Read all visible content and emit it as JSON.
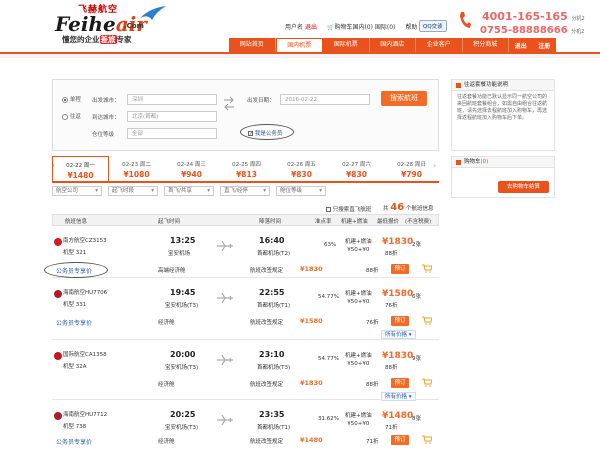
{
  "header": {
    "logo_cn": "飞赫航空",
    "logo_en_a": "Feihe",
    "logo_en_b": "air",
    "logo_com": ".Com",
    "slogan_a": "懂您的企业",
    "slogan_hl": "差旅",
    "slogan_b": "专家",
    "user_center": "用户名",
    "user_link": "退出",
    "cart_text": "购物车",
    "cart_count": "国内(0) 国际(0)",
    "help": "帮助",
    "qq": "QQ交谈",
    "phone1": "4001-165-165",
    "phone1_suffix": "分机2",
    "phone2": "0755-88888666",
    "phone2_suffix": "分机2"
  },
  "nav": {
    "items": [
      "网站首页",
      "国内机票",
      "国际机票",
      "国内酒店",
      "企业客户",
      "积分商城"
    ],
    "active_index": 1,
    "right": [
      "退出",
      "注册"
    ]
  },
  "search": {
    "trip_one": "单程",
    "trip_round": "往返",
    "from_label": "出发城市：",
    "from_value": "深圳",
    "to_label": "到达城市：",
    "to_value": "北京(首都)",
    "cabin_label": "仓位等级",
    "cabin_value": "全部",
    "date_label": "出发日期：",
    "date_value": "2016-02-22",
    "official_label": "我是公务员",
    "search_button": "搜索航班"
  },
  "side": {
    "notice_title": "往返套餐功能说明",
    "notice_body": "往返套餐功能已默认显示同一航空公司的来回航班套餐组合，如需自由组合往返航班，请先选择去程航班加入购物车，再选择返程航班加入购物车后下单。",
    "cart_title": "购物车",
    "cart_count": "(0)",
    "cart_button": "去购物车结算"
  },
  "dates": [
    {
      "date": "02-22",
      "dow": "周一",
      "price": "¥1480",
      "active": true
    },
    {
      "date": "02-23",
      "dow": "周二",
      "price": "¥1080",
      "active": false
    },
    {
      "date": "02-24",
      "dow": "周三",
      "price": "¥940",
      "active": false
    },
    {
      "date": "02-25",
      "dow": "周四",
      "price": "¥813",
      "active": false
    },
    {
      "date": "02-26",
      "dow": "周五",
      "price": "¥830",
      "active": false
    },
    {
      "date": "02-27",
      "dow": "周六",
      "price": "¥830",
      "active": false
    },
    {
      "date": "02-28",
      "dow": "周日",
      "price": "¥790",
      "active": false
    }
  ],
  "filters": [
    "航空公司",
    "起飞时段",
    "首飞/共享",
    "直飞/经停",
    "舱位等级"
  ],
  "results": {
    "direct_only": "只搜索直飞航班",
    "count_prefix": "共",
    "count": "46",
    "count_suffix": "个航班信息",
    "columns": [
      "航班信息",
      "起飞时间",
      "降落时间",
      "准点率",
      "机建+燃油",
      "最低报价",
      "(不含税费)"
    ]
  },
  "flights": [
    {
      "airline": "南方航空CZ3153",
      "model": "机型 321",
      "dep_time": "13:25",
      "dep_apt": "宝安机场",
      "arr_time": "16:40",
      "arr_apt": "首都机场(T2)",
      "ontime": "63%",
      "tax_a": "机建+燃油",
      "tax_b": "¥50+¥0",
      "price": "¥1830",
      "stock": "2张",
      "disc": "88折",
      "book": "预订",
      "sub_a": "高端经济舱",
      "sub_b": "航班改签规定",
      "sub_price": "¥1830",
      "sub_disc": "88折",
      "gwy": "公务员专享价"
    },
    {
      "airline": "海南航空HU7706",
      "model": "机型 331",
      "dep_time": "19:45",
      "dep_apt": "宝安机场(T3)",
      "arr_time": "22:55",
      "arr_apt": "首都机场(T1)",
      "ontime": "54.77%",
      "tax_a": "机建+燃油",
      "tax_b": "¥50+¥0",
      "price": "¥1580",
      "stock": "6张",
      "disc": "76折",
      "book": "预订",
      "sub_a": "经济舱",
      "sub_b": "航班改签规定",
      "sub_price": "¥1580",
      "sub_disc": "76折",
      "gwy": "公务员专享价",
      "more": "所有价格"
    },
    {
      "airline": "国际航空CA1358",
      "model": "机型 32A",
      "dep_time": "20:00",
      "dep_apt": "宝安机场(T3)",
      "arr_time": "23:10",
      "arr_apt": "首都机场(T3)",
      "ontime": "54.77%",
      "tax_a": "机建+燃油",
      "tax_b": "¥50+¥0",
      "price": "¥1830",
      "stock": "9张",
      "disc": "88折",
      "book": "预订",
      "sub_a": "经济舱",
      "sub_b": "航班改签规定",
      "sub_price": "¥1830",
      "sub_disc": "88折",
      "more": "所有价格"
    },
    {
      "airline": "海南航空HU7712",
      "model": "机型 738",
      "dep_time": "20:25",
      "dep_apt": "宝安机场(T3)",
      "arr_time": "23:35",
      "arr_apt": "首都机场(T1)",
      "ontime": "31.62%",
      "tax_a": "机建+燃油",
      "tax_b": "¥50+¥0",
      "price": "¥1480",
      "stock": "8张",
      "disc": "71折",
      "book": "预订",
      "sub_a": "经济舱",
      "sub_b": "航班改签规定",
      "sub_price": "¥1480",
      "sub_disc": "71折",
      "gwy": "公务员专享价"
    }
  ]
}
